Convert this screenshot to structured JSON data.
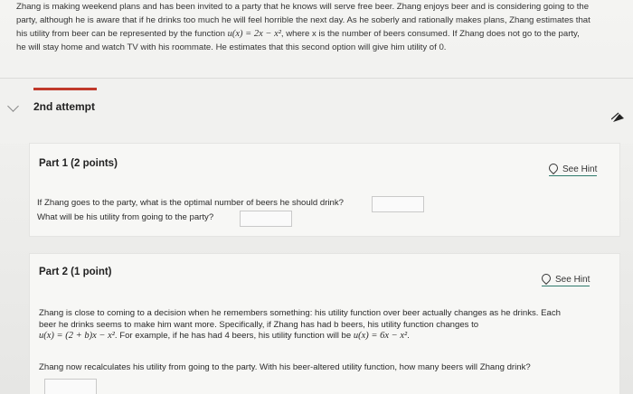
{
  "intro": {
    "line1": "Zhang is making weekend plans and has been invited to a party that he knows will serve free beer. Zhang enjoys beer and is considering going to the",
    "line2": "party, although he is aware that if he drinks too much he will feel horrible the next day. As he soberly and rationally makes plans, Zhang estimates that",
    "line3a": "his utility from beer can be represented by the function ",
    "line3_formula": "u(x) = 2x − x²",
    "line3b": ", where x is the number of beers consumed. If Zhang does not go to the party,",
    "line4": "he will stay home and watch TV with his roommate. He estimates that this second option will give him utility of 0."
  },
  "attempt": {
    "title": "2nd attempt"
  },
  "part1": {
    "title": "Part 1   (2 points)",
    "hint": "See Hint",
    "q1": "If Zhang goes to the party, what is the optimal number of beers he should drink?",
    "q2": "What will be his utility from going to the party?"
  },
  "part2": {
    "title": "Part 2   (1 point)",
    "hint": "See Hint",
    "line1": "Zhang is close to coming to a decision when he remembers something: his utility function over beer actually changes as he drinks. Each",
    "line2": "beer he drinks seems to make him want more. Specifically, if Zhang has had b beers, his utility function changes to",
    "line3_formula": "u(x) = (2 + b)x − x²",
    "line3b": ". For example, if he has had 4 beers, his utility function will be ",
    "line3_formula2": "u(x) = 6x − x²",
    "line3c": ".",
    "question": "Zhang now recalculates his utility from going to the party. With his beer-altered utility function, how many beers will Zhang drink?"
  },
  "icons": {
    "collapse": "chevron-down-icon",
    "hint": "lightbulb-icon",
    "nav": "arrow-up-icon"
  },
  "colors": {
    "accent": "#c0392b",
    "hint_underline": "#2f7a6c"
  }
}
